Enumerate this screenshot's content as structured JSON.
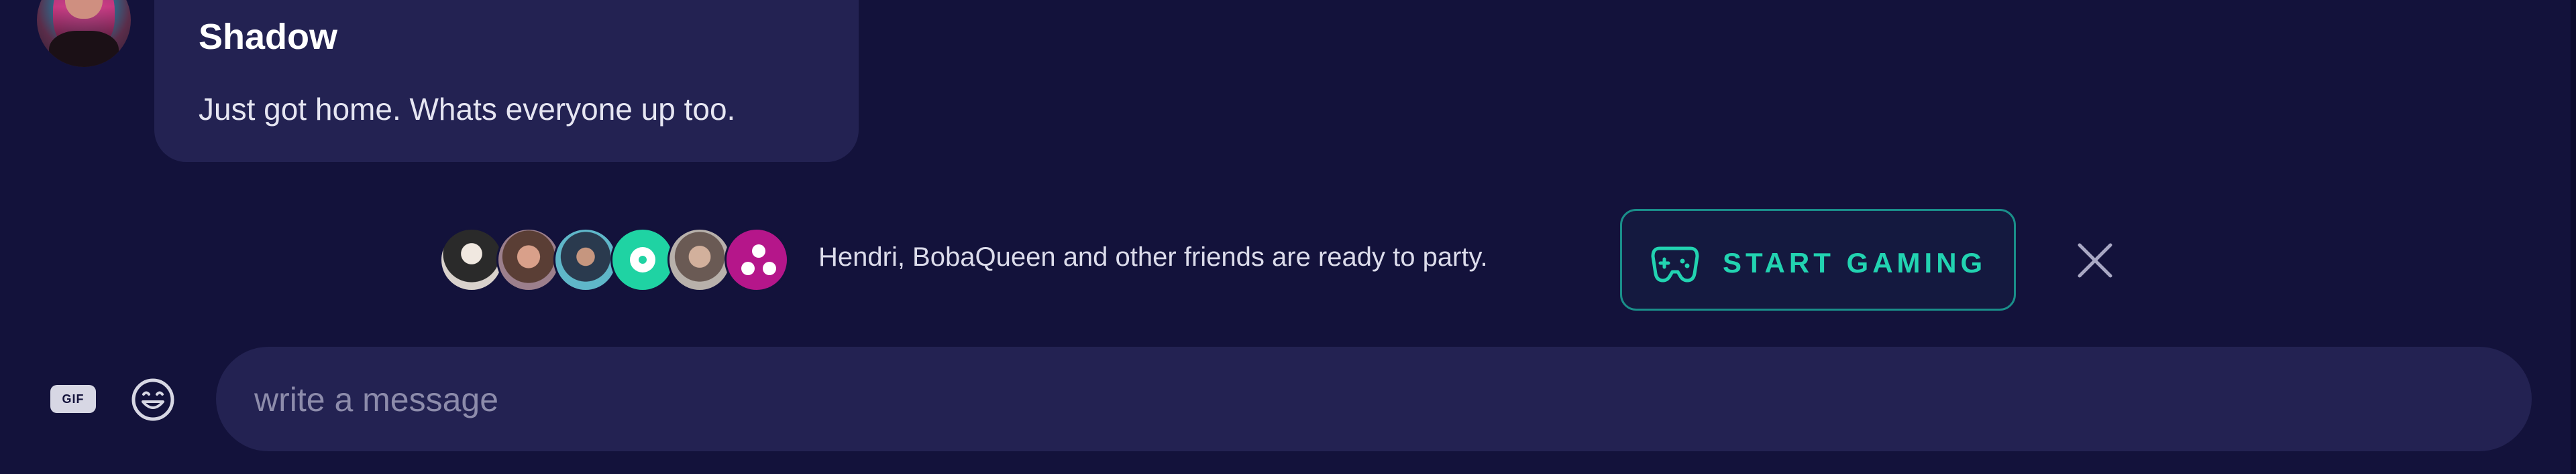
{
  "message": {
    "author": "Shadow",
    "text": "Just got home. Whats everyone up too."
  },
  "party": {
    "text": "Hendri, BobaQueen and other friends are ready to party.",
    "start_button_label": "START GAMING",
    "start_button_icon": "gamepad-icon",
    "close_icon": "close-icon",
    "avatars": [
      "friend-1",
      "friend-2",
      "friend-3",
      "friend-4",
      "friend-5",
      "friend-6"
    ]
  },
  "composer": {
    "gif_label": "GIF",
    "placeholder": "write a message",
    "value": ""
  },
  "colors": {
    "background": "#13123b",
    "bubble": "#232252",
    "accent": "#22d3b1",
    "accent_border": "#1a8f8a",
    "pink_avatar": "#b5168a",
    "teal_avatar": "#1fd3a3"
  }
}
